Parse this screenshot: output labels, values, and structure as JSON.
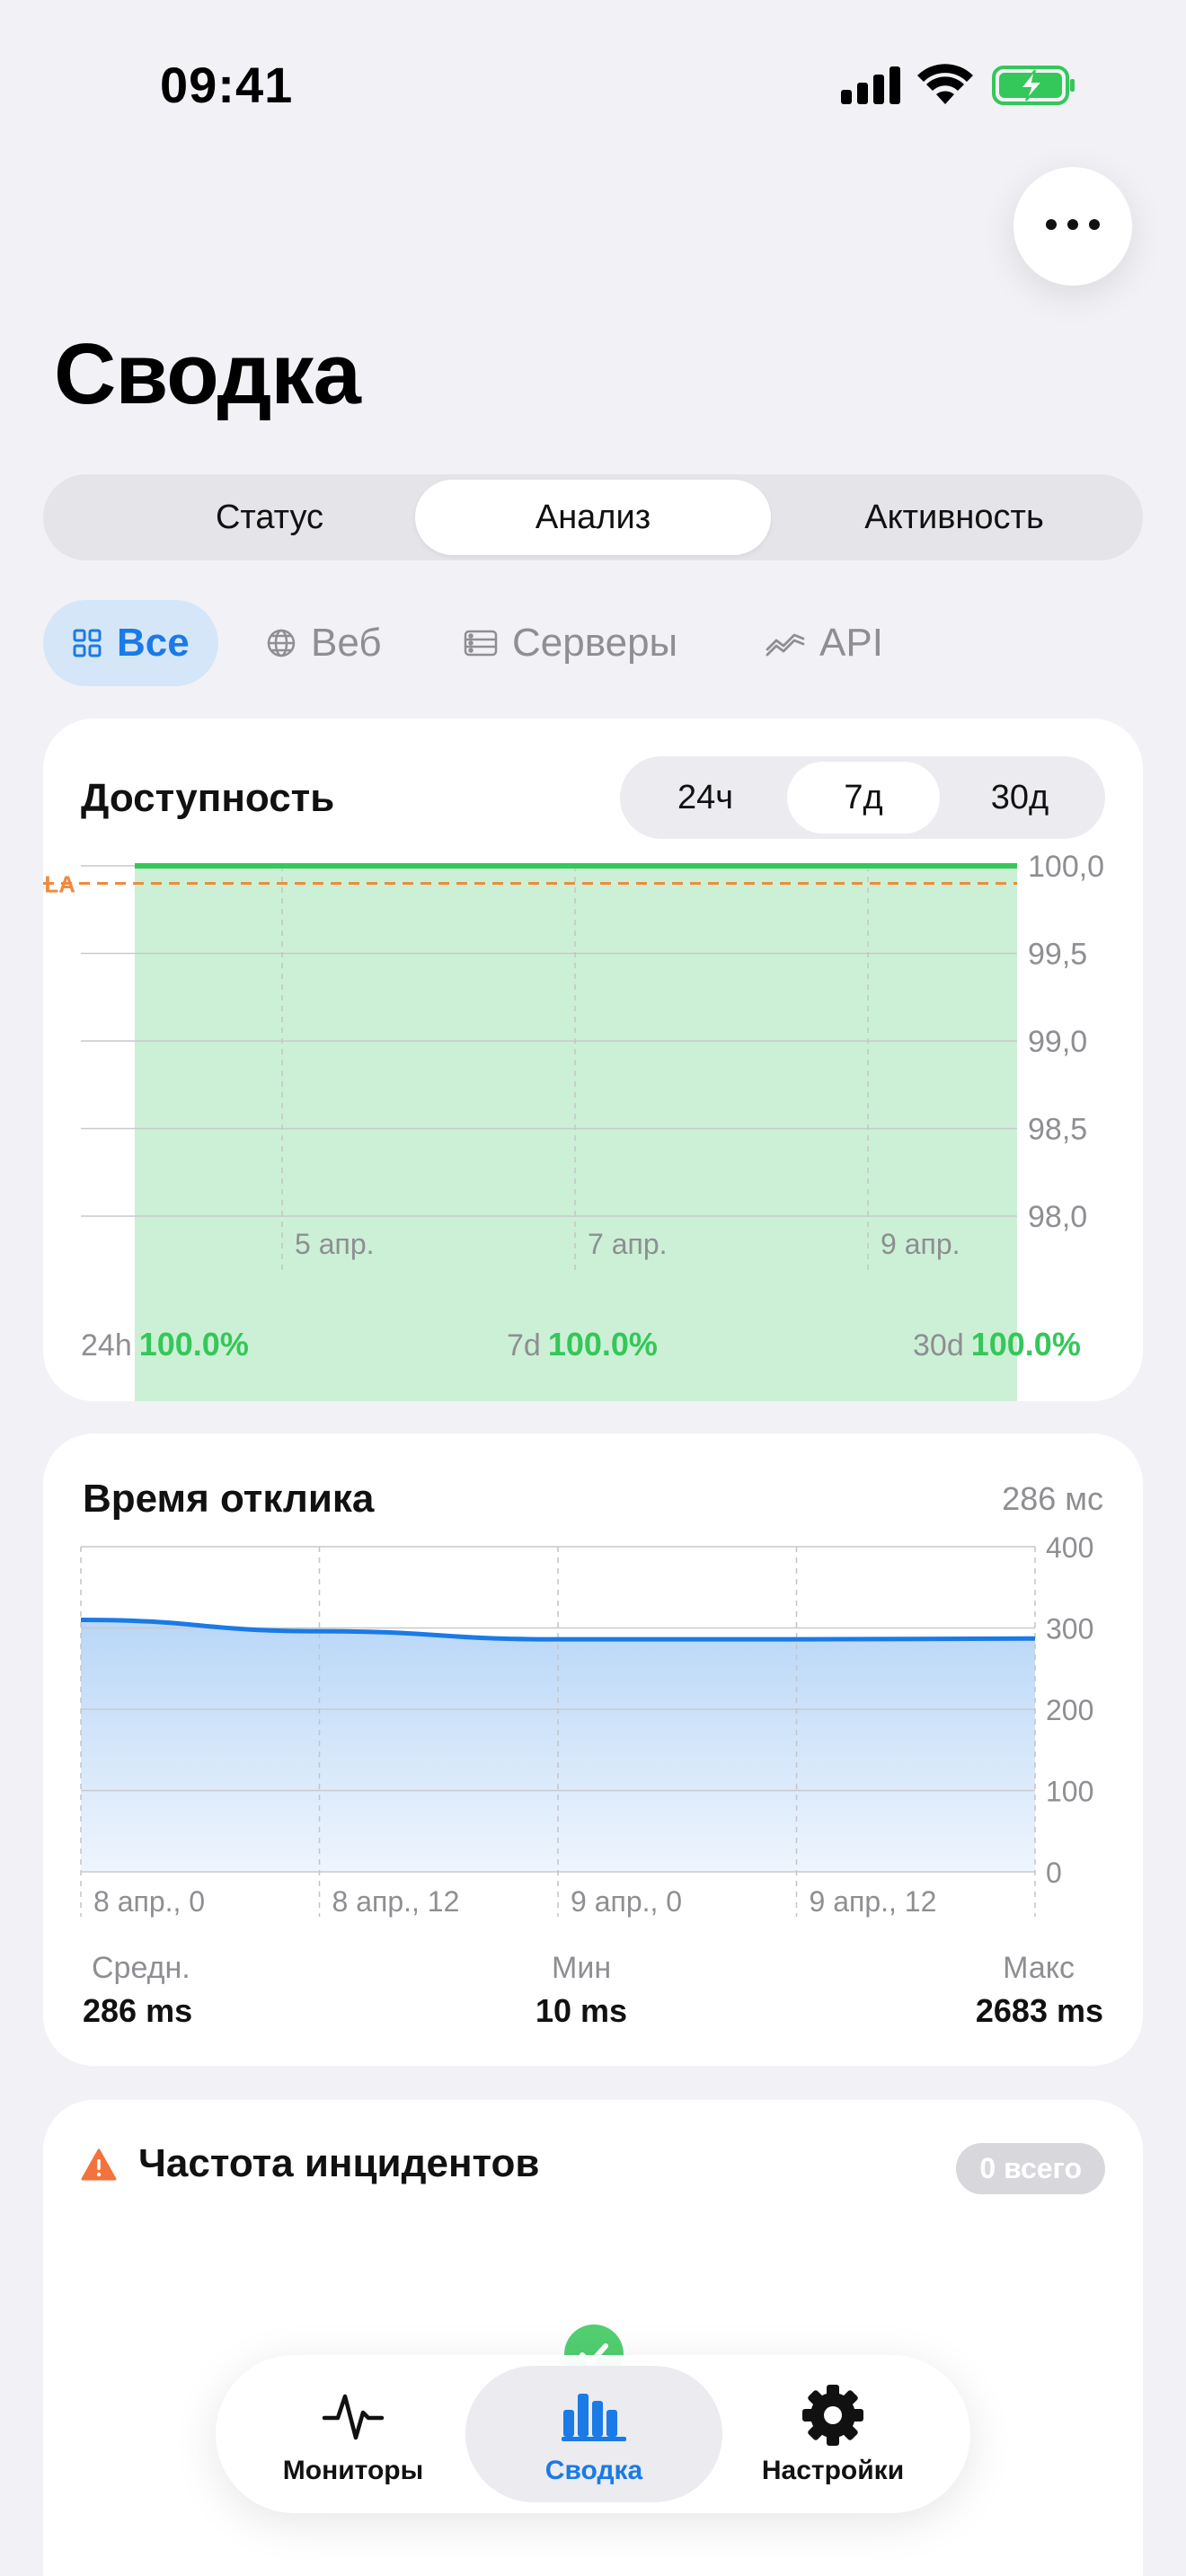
{
  "status_bar": {
    "time": "09:41"
  },
  "header": {
    "title": "Сводка"
  },
  "segments": {
    "items": [
      "Статус",
      "Анализ",
      "Активность"
    ],
    "active": "Анализ"
  },
  "filters": {
    "items": [
      {
        "label": "Все",
        "icon": "grid-icon"
      },
      {
        "label": "Веб",
        "icon": "globe-icon"
      },
      {
        "label": "Серверы",
        "icon": "server-icon"
      },
      {
        "label": "API",
        "icon": "api-wave-icon"
      }
    ],
    "active": "Все"
  },
  "availability": {
    "title": "Доступность",
    "ranges": [
      "24ч",
      "7д",
      "30д"
    ],
    "active_range": "7д",
    "sla_label": "SLA",
    "stats": [
      {
        "period": "24h",
        "value": "100.0%"
      },
      {
        "period": "7d",
        "value": "100.0%"
      },
      {
        "period": "30d",
        "value": "100.0%"
      }
    ]
  },
  "response": {
    "title": "Время отклика",
    "current": "286 мс",
    "stats": [
      {
        "label": "Средн.",
        "value": "286 ms"
      },
      {
        "label": "Мин",
        "value": "10 ms"
      },
      {
        "label": "Макс",
        "value": "2683 ms"
      }
    ]
  },
  "incidents": {
    "title": "Частота инцидентов",
    "badge": "0 всего"
  },
  "tab_bar": {
    "items": [
      {
        "label": "Мониторы",
        "icon": "pulse-icon"
      },
      {
        "label": "Сводка",
        "icon": "bar-chart-icon"
      },
      {
        "label": "Настройки",
        "icon": "gear-icon"
      }
    ],
    "active": "Сводка"
  },
  "colors": {
    "accent": "#1a7ae6",
    "success": "#34c759",
    "sla": "#f08a3c",
    "warning": "#f4723b"
  },
  "chart_data": [
    {
      "type": "area",
      "title": "Доступность",
      "x_ticks": [
        "5 апр.",
        "7 апр.",
        "9 апр."
      ],
      "y_ticks": [
        "100,0",
        "99,5",
        "99,0",
        "98,5",
        "98,0"
      ],
      "ylim": [
        98.0,
        100.0
      ],
      "series": [
        {
          "values": [
            100.0,
            100.0,
            100.0,
            100.0,
            100.0,
            100.0,
            100.0
          ]
        }
      ],
      "sla": 99.9,
      "grid": true
    },
    {
      "type": "area",
      "title": "Время отклика",
      "x_ticks": [
        "8 апр., 0",
        "8 апр., 12",
        "9 апр., 0",
        "9 апр., 12"
      ],
      "y_ticks": [
        "400",
        "300",
        "200",
        "100",
        "0"
      ],
      "ylim": [
        0,
        400
      ],
      "series": [
        {
          "values": [
            310,
            296,
            286,
            286,
            287
          ]
        }
      ],
      "grid": true
    }
  ]
}
